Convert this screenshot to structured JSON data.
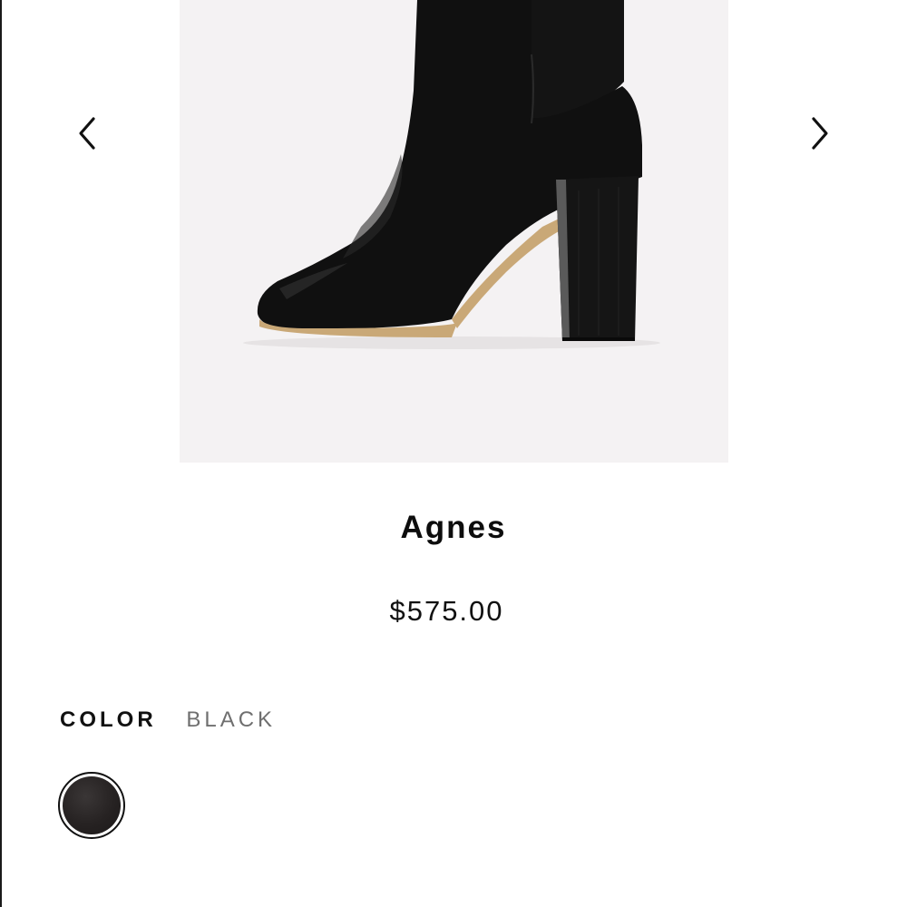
{
  "product": {
    "title": "Agnes",
    "price": "$575.00"
  },
  "gallery": {
    "image_alt": "Agnes black leather heeled boot",
    "prev_icon": "chevron-left-icon",
    "next_icon": "chevron-right-icon"
  },
  "color": {
    "label": "COLOR",
    "selected": "BLACK",
    "swatches": [
      {
        "name": "BLACK",
        "hex": "#262222",
        "selected": true
      }
    ]
  },
  "colors": {
    "page_bg": "#ffffff",
    "image_bg": "#f4f2f3",
    "text": "#111111",
    "muted_text": "#6f6f6f"
  }
}
